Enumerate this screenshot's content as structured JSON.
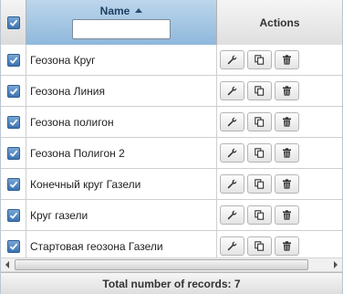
{
  "header": {
    "name_label": "Name",
    "actions_label": "Actions",
    "filter_value": "",
    "filter_placeholder": "",
    "select_all_checked": true,
    "sort": "ascending"
  },
  "rows": [
    {
      "name": "Геозона Круг",
      "checked": true
    },
    {
      "name": "Геозона Линия",
      "checked": true
    },
    {
      "name": "Геозона полигон",
      "checked": true
    },
    {
      "name": "Геозона Полигон 2",
      "checked": true
    },
    {
      "name": "Конечный круг Газели",
      "checked": true
    },
    {
      "name": "Круг газели",
      "checked": true
    },
    {
      "name": "Стартовая геозона Газели",
      "checked": true
    }
  ],
  "row_actions": [
    "wrench-icon",
    "copy-icon",
    "trash-icon"
  ],
  "footer": {
    "total_text": "Total number of records: 7"
  },
  "colors": {
    "header_name_bg": "#9fc3e2",
    "checkbox_fill": "#4a7fb9",
    "border": "#cfcfcf"
  }
}
